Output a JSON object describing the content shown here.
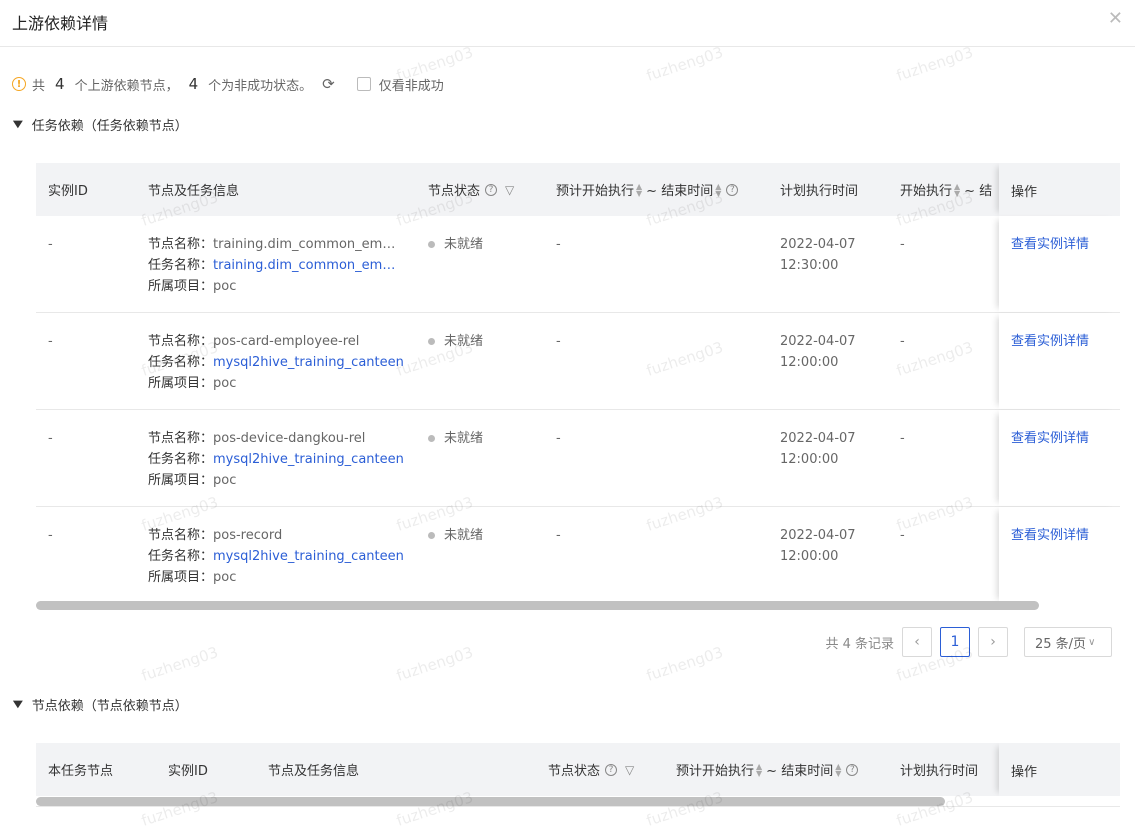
{
  "dialog": {
    "title": "上游依赖详情",
    "close_icon": "close-icon"
  },
  "summary": {
    "prefix": "共",
    "total": "4",
    "mid": "个上游依赖节点，",
    "failed": "4",
    "suffix": "个为非成功状态。",
    "only_failed_label": "仅看非成功"
  },
  "task_section": {
    "title": "任务依赖（任务依赖节点）",
    "headers": {
      "instance_id": "实例ID",
      "node_info": "节点及任务信息",
      "node_status": "节点状态",
      "planned_start": "预计开始执行",
      "end_time": "~ 结束时间",
      "plan_time": "计划执行时间",
      "start_exec": "开始执行",
      "end_trunc": "~ 结",
      "ops": "操作"
    },
    "label_node": "节点名称：",
    "label_task": "任务名称：",
    "label_project": "所属项目：",
    "rows": [
      {
        "instance_id": "-",
        "node_name": "training.dim_common_empl...",
        "task_name": "training.dim_common_empl...",
        "project": "poc",
        "status": "未就绪",
        "planned": "-",
        "plan_date": "2022-04-07",
        "plan_time": "12:30:00",
        "start": "-",
        "op": "查看实例详情"
      },
      {
        "instance_id": "-",
        "node_name": "pos-card-employee-rel",
        "task_name": "mysql2hive_training_canteen",
        "project": "poc",
        "status": "未就绪",
        "planned": "-",
        "plan_date": "2022-04-07",
        "plan_time": "12:00:00",
        "start": "-",
        "op": "查看实例详情"
      },
      {
        "instance_id": "-",
        "node_name": "pos-device-dangkou-rel",
        "task_name": "mysql2hive_training_canteen",
        "project": "poc",
        "status": "未就绪",
        "planned": "-",
        "plan_date": "2022-04-07",
        "plan_time": "12:00:00",
        "start": "-",
        "op": "查看实例详情"
      },
      {
        "instance_id": "-",
        "node_name": "pos-record",
        "task_name": "mysql2hive_training_canteen",
        "project": "poc",
        "status": "未就绪",
        "planned": "-",
        "plan_date": "2022-04-07",
        "plan_time": "12:00:00",
        "start": "-",
        "op": "查看实例详情"
      }
    ]
  },
  "pagination": {
    "total_text": "共 4 条记录",
    "current_page": "1",
    "page_size": "25 条/页"
  },
  "node_section": {
    "title": "节点依赖（节点依赖节点）",
    "headers": {
      "this_node": "本任务节点",
      "instance_id": "实例ID",
      "node_info": "节点及任务信息",
      "node_status": "节点状态",
      "planned_start": "预计开始执行",
      "end_time": "~ 结束时间",
      "plan_time": "计划执行时间",
      "ops": "操作"
    }
  },
  "watermark": "fuzheng03"
}
